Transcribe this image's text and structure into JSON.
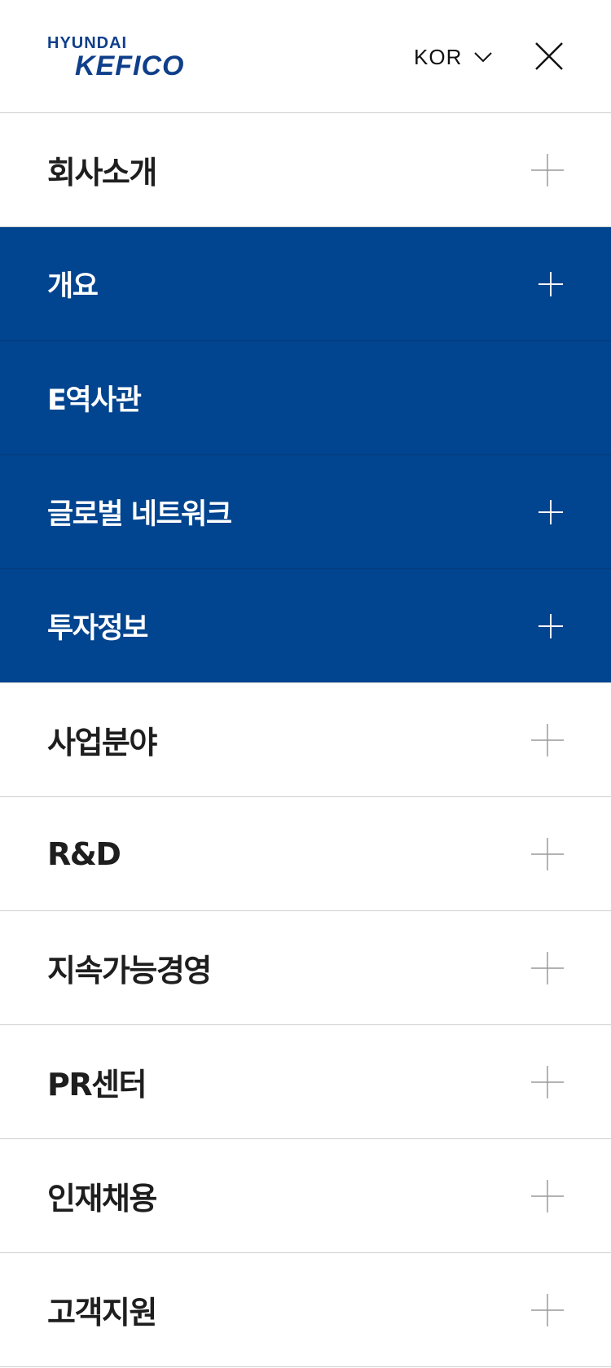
{
  "header": {
    "logo_top": "HYUNDAI",
    "logo_main": "KEFICO",
    "language": "KOR",
    "colors": {
      "brand": "#0f3f8a",
      "submenu_bg": "#01448f"
    }
  },
  "menu": {
    "company": {
      "label": "회사소개"
    },
    "company_sub": [
      {
        "label": "개요"
      },
      {
        "label": "E역사관"
      },
      {
        "label": "글로벌 네트워크"
      },
      {
        "label": "투자정보"
      }
    ],
    "business": {
      "label": "사업분야"
    },
    "rnd": {
      "label": "R&D"
    },
    "sustainability": {
      "label": "지속가능경영"
    },
    "pr": {
      "label": "PR센터"
    },
    "recruit": {
      "label": "인재채용"
    },
    "support": {
      "label": "고객지원"
    }
  },
  "icons": {
    "close": "close-icon",
    "chevron": "chevron-down-icon",
    "expand": "plus-icon"
  }
}
